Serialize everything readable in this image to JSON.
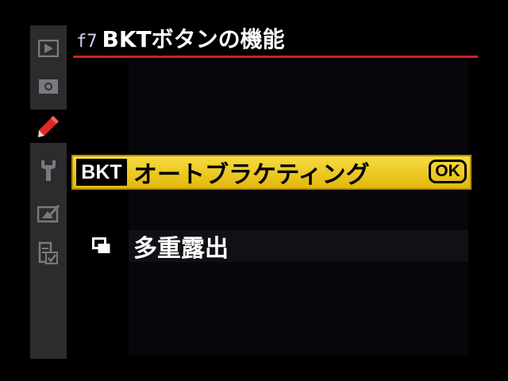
{
  "header": {
    "menu_code": "f7",
    "title": "BKTボタンの機能"
  },
  "sidebar": {
    "items": [
      {
        "name": "playback-menu",
        "icon": "playback-icon",
        "active": false
      },
      {
        "name": "shooting-menu",
        "icon": "camera-icon",
        "active": false
      },
      {
        "name": "custom-settings-menu",
        "icon": "pencil-icon",
        "active": true
      },
      {
        "name": "setup-menu",
        "icon": "wrench-icon",
        "active": false
      },
      {
        "name": "retouch-menu",
        "icon": "retouch-icon",
        "active": false
      },
      {
        "name": "my-menu",
        "icon": "my-menu-icon",
        "active": false
      }
    ]
  },
  "options": [
    {
      "icon_label": "BKT",
      "label": "オートブラケティング",
      "selected": true,
      "ok_label": "OK"
    },
    {
      "icon": "multiple-exposure-icon",
      "label": "多重露出",
      "selected": false
    }
  ],
  "colors": {
    "accent_red": "#d02020",
    "highlight_yellow": "#f0cc2a",
    "sidebar_gray": "#2c2c2e",
    "pencil_red": "#e02828"
  }
}
